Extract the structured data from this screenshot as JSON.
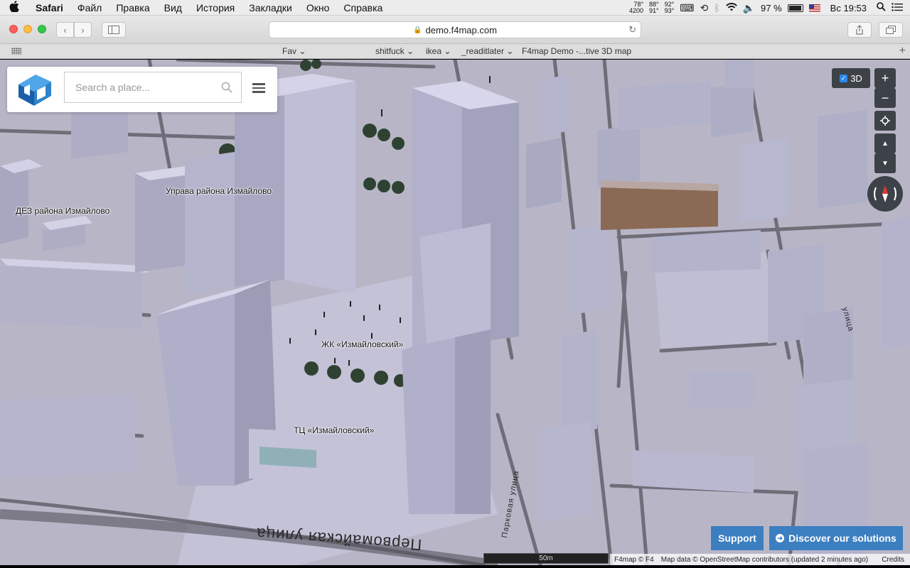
{
  "menubar": {
    "app": "Safari",
    "items": [
      "Файл",
      "Правка",
      "Вид",
      "История",
      "Закладки",
      "Окно",
      "Справка"
    ],
    "stats": {
      "temp_top": "78°",
      "temp_bottom": "4200",
      "col2_top": "88°",
      "col2_bottom": "91°",
      "col3_top": "92°",
      "col3_bottom": "93°"
    },
    "battery": "97 %",
    "clock": "Вс 19:53"
  },
  "browser": {
    "url": "demo.f4map.com",
    "favorites": [
      "Fav",
      "shitfuck",
      "ikea",
      "_readitlater",
      "F4map Demo -...tive 3D map"
    ]
  },
  "search": {
    "placeholder": "Search a place..."
  },
  "map": {
    "labels": [
      {
        "text": "Управа района Измайлово"
      },
      {
        "text": "ДЕЗ района Измайлово"
      },
      {
        "text": "ЖК «Измайловский»"
      },
      {
        "text": "ТЦ «Измайловский»"
      }
    ],
    "streets": {
      "main": "Первомайская улица",
      "side": "Парковая улица",
      "side2": "улица"
    }
  },
  "controls": {
    "toggle_3d": "3D",
    "zoom_in": "+",
    "zoom_out": "−"
  },
  "footer": {
    "support": "Support",
    "discover": "Discover our solutions",
    "scale": "50m",
    "copyright": "F4map © F4",
    "mapdata": "Map data © OpenStreetMap contributors (updated 2 minutes ago)",
    "credits": "Credits"
  },
  "colors": {
    "accent": "#3c7fc1",
    "building": "#c9c8e0",
    "ground": "#b9b7c6",
    "road": "#6c6c74"
  }
}
